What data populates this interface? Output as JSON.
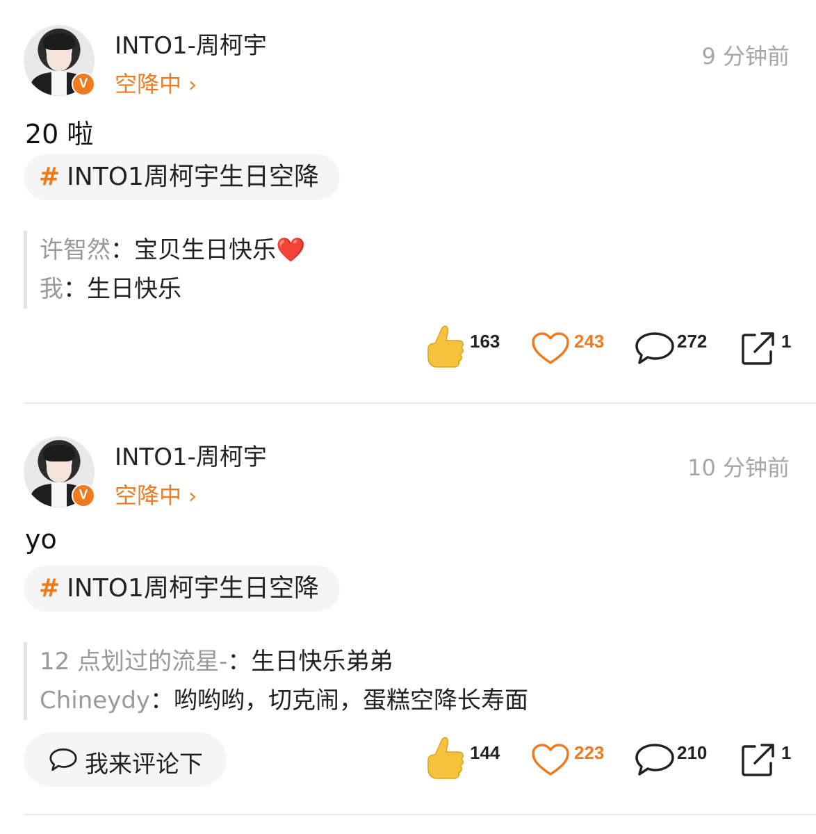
{
  "colors": {
    "accent": "#f07a1f",
    "muted": "#999999",
    "time": "#a6a6a6"
  },
  "posts": [
    {
      "username": "INTO1-周柯宇",
      "status": "空降中",
      "time": "9 分钟前",
      "text": "20 啦",
      "topic": "INTO1周柯宇生日空降",
      "quotes": [
        {
          "name": "许智然",
          "sep": "：",
          "content": "宝贝生日快乐",
          "emoji": "❤️"
        },
        {
          "name": "我",
          "sep": "：",
          "content": "生日快乐",
          "emoji": ""
        }
      ],
      "stats": {
        "likes": "163",
        "hearts": "243",
        "comments": "272",
        "shares": "1"
      }
    },
    {
      "username": "INTO1-周柯宇",
      "status": "空降中",
      "time": "10 分钟前",
      "text": "yo",
      "topic": "INTO1周柯宇生日空降",
      "quotes": [
        {
          "name": "12 点划过的流星-",
          "sep": "：",
          "content": "生日快乐弟弟",
          "emoji": ""
        },
        {
          "name": "Chineydy",
          "sep": "：",
          "content": "哟哟哟，切克闹，蛋糕空降长寿面",
          "emoji": ""
        }
      ],
      "stats": {
        "likes": "144",
        "hearts": "223",
        "comments": "210",
        "shares": "1"
      },
      "comment_button": "我来评论下"
    }
  ],
  "badge": "V"
}
